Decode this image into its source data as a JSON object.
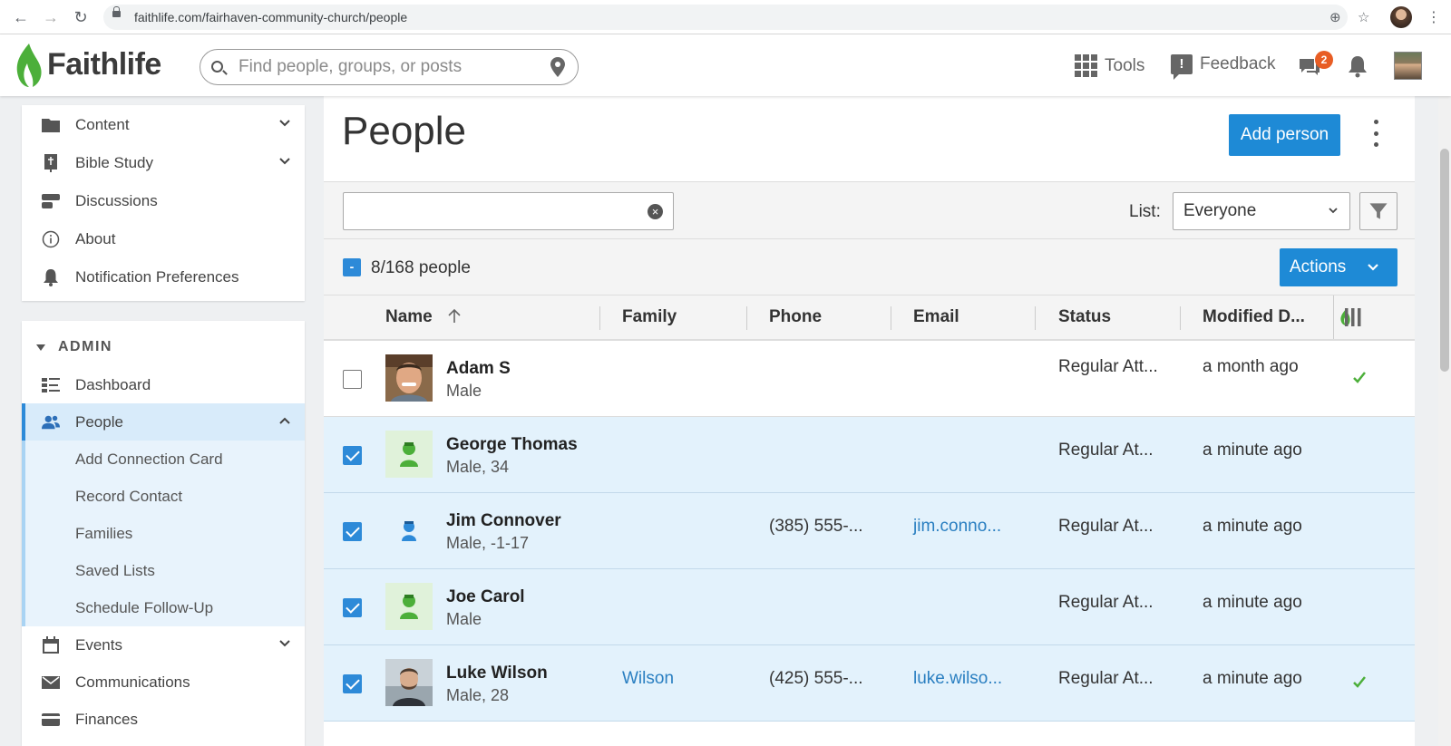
{
  "browser": {
    "url": "faithlife.com/fairhaven-community-church/people"
  },
  "header": {
    "logo_text": "Faithlife",
    "search_placeholder": "Find people, groups, or posts",
    "tools_label": "Tools",
    "feedback_label": "Feedback",
    "feedback_glyph": "!",
    "messages_badge": "2"
  },
  "sidebar": {
    "top_items": [
      {
        "label": "Content",
        "icon": "folder-icon"
      },
      {
        "label": "Bible Study",
        "icon": "bible-icon"
      },
      {
        "label": "Discussions",
        "icon": "discussion-icon"
      },
      {
        "label": "About",
        "icon": "info-icon"
      },
      {
        "label": "Notification Preferences",
        "icon": "bell-icon"
      }
    ],
    "admin_label": "ADMIN",
    "admin_items": [
      {
        "label": "Dashboard",
        "icon": "dashboard-icon"
      },
      {
        "label": "People",
        "icon": "people-icon"
      },
      {
        "label": "Add Connection Card"
      },
      {
        "label": "Record Contact"
      },
      {
        "label": "Families"
      },
      {
        "label": "Saved Lists"
      },
      {
        "label": "Schedule Follow-Up"
      },
      {
        "label": "Events",
        "icon": "calendar-icon"
      },
      {
        "label": "Communications",
        "icon": "envelope-icon"
      },
      {
        "label": "Finances",
        "icon": "credit-card-icon"
      }
    ]
  },
  "main": {
    "title": "People",
    "add_button": "Add person",
    "list_label": "List:",
    "list_value": "Everyone",
    "count_text": "8/168 people",
    "partial_glyph": "-",
    "actions_label": "Actions",
    "clear_glyph": "×",
    "columns": [
      "Name",
      "Family",
      "Phone",
      "Email",
      "Status",
      "Modified D..."
    ]
  },
  "rows": [
    {
      "name": "Adam S",
      "sub": "Male",
      "family": "",
      "phone": "",
      "email": "",
      "status": "Regular Att...",
      "modified": "a month ago",
      "selected": false,
      "check": true
    },
    {
      "name": "George Thomas",
      "sub": "Male, 34",
      "family": "",
      "phone": "",
      "email": "",
      "status": "Regular At...",
      "modified": "a minute ago",
      "selected": true,
      "check": false
    },
    {
      "name": "Jim Connover",
      "sub": "Male, -1-17",
      "family": "",
      "phone": "(385) 555-...",
      "email": "jim.conno...",
      "status": "Regular At...",
      "modified": "a minute ago",
      "selected": true,
      "check": false
    },
    {
      "name": "Joe Carol",
      "sub": "Male",
      "family": "",
      "phone": "",
      "email": "",
      "status": "Regular At...",
      "modified": "a minute ago",
      "selected": true,
      "check": false
    },
    {
      "name": "Luke Wilson",
      "sub": "Male, 28",
      "family": "Wilson",
      "phone": "(425) 555-...",
      "email": "luke.wilso...",
      "status": "Regular At...",
      "modified": "a minute ago",
      "selected": true,
      "check": true
    }
  ],
  "colors": {
    "accent": "#1e8ad6",
    "brand_green": "#4caf3a",
    "badge": "#e85d24"
  }
}
